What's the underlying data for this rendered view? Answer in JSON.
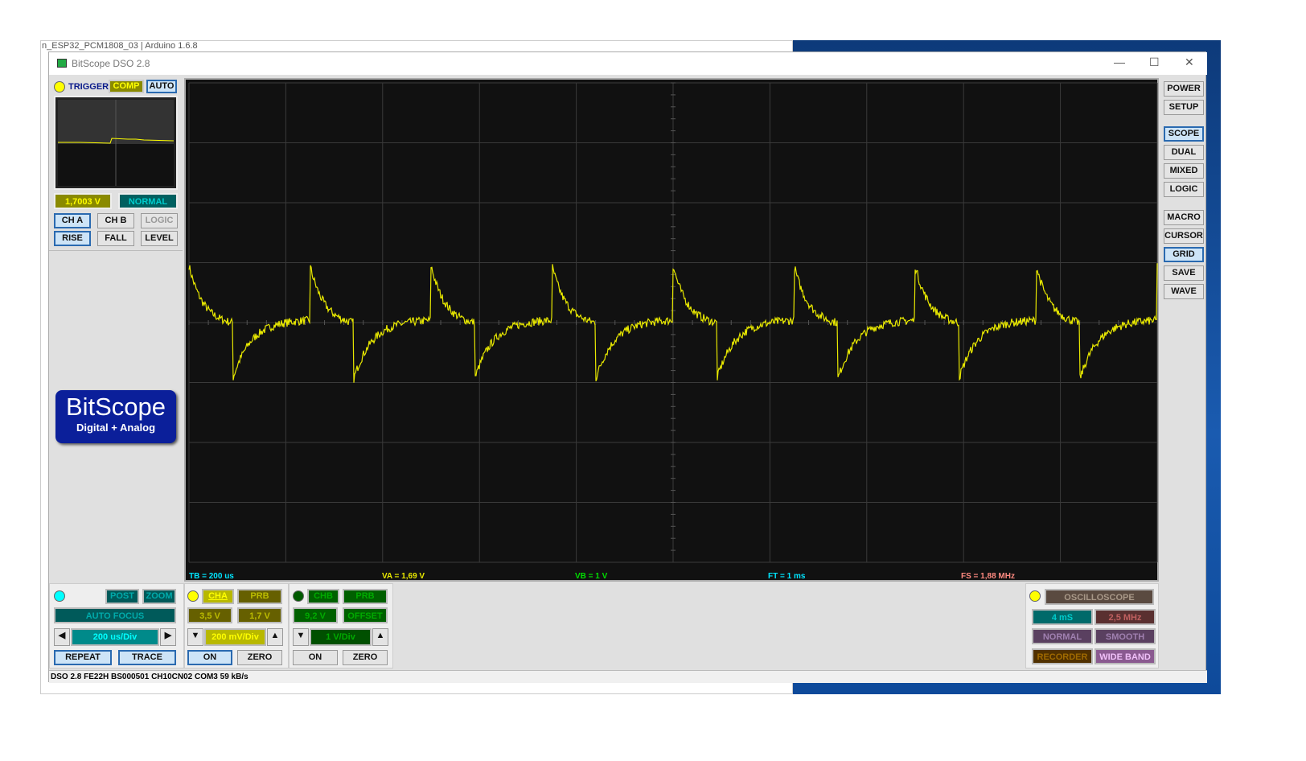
{
  "background_window": {
    "title": "n_ESP32_PCM1808_03 | Arduino 1.6.8"
  },
  "window": {
    "title": "BitScope DSO 2.8",
    "minimize": "—",
    "maximize": "☐",
    "close": "✕"
  },
  "trigger": {
    "label": "TRIGGER",
    "comp": "COMP",
    "auto": "AUTO",
    "level_value": "1,7003 V",
    "mode": "NORMAL",
    "source_buttons": [
      "CH A",
      "CH B",
      "LOGIC"
    ],
    "edge_buttons": [
      "RISE",
      "FALL",
      "LEVEL"
    ],
    "selected_source": "CH A",
    "selected_edge": "RISE"
  },
  "logo": {
    "name": "BitScope",
    "tagline": "Digital + Analog"
  },
  "right_menu": {
    "items": [
      "POWER",
      "SETUP",
      "SCOPE",
      "DUAL",
      "MIXED",
      "LOGIC",
      "MACRO",
      "CURSOR",
      "GRID",
      "SAVE",
      "WAVE"
    ],
    "selected": [
      "SCOPE",
      "GRID"
    ]
  },
  "readouts": {
    "tb": "TB = 200 us",
    "va": "VA = 1,69 V",
    "vb": "VB = 1 V",
    "ft": "FT = 1 ms",
    "fs": "FS = 1,88 MHz"
  },
  "timebase": {
    "post": "POST",
    "zoom": "ZOOM",
    "auto_focus": "AUTO FOCUS",
    "value": "200 us/Div",
    "repeat": "REPEAT",
    "trace": "TRACE"
  },
  "cha": {
    "label": "CHA",
    "prb": "PRB",
    "range": "3,5 V",
    "offset": "1,7 V",
    "value": "200 mV/Div",
    "on": "ON",
    "zero": "ZERO"
  },
  "chb": {
    "label": "CHB",
    "prb": "PRB",
    "range": "9,2 V",
    "offset": "OFFSET",
    "value": "1 V/Div",
    "on": "ON",
    "zero": "ZERO"
  },
  "mode_panel": {
    "mode": "OSCILLOSCOPE",
    "duration": "4 mS",
    "rate": "2,5 MHz",
    "normal": "NORMAL",
    "smooth": "SMOOTH",
    "recorder": "RECORDER",
    "wide_band": "WIDE BAND"
  },
  "status_bar": "DSO 2.8 FE22H BS000501 CH10CN02 COM3 59 kB/s",
  "colors": {
    "cha": "#e8e800",
    "chb": "#00cc00",
    "timebase": "#00e5ff",
    "screen": "#111111"
  },
  "waveform": {
    "channel": "CHA",
    "volts_per_div": 0.2,
    "time_per_div_us": 200,
    "period_us": 250
  }
}
